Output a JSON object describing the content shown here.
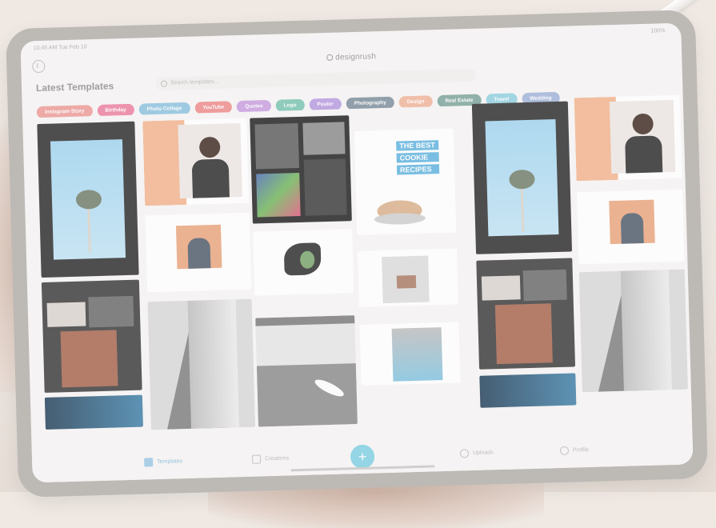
{
  "app": {
    "status_time": "10:45 AM  Tue Feb 10",
    "status_battery": "100%",
    "logo_text": "designrush",
    "page_title": "Latest Templates",
    "search_placeholder": "Search templates..."
  },
  "categories": [
    {
      "label": "Instagram Story",
      "color": "#ec9c97"
    },
    {
      "label": "Birthday",
      "color": "#ec7fa0"
    },
    {
      "label": "Photo Collage",
      "color": "#8cc2df"
    },
    {
      "label": "YouTube",
      "color": "#ee8a8a"
    },
    {
      "label": "Quotes",
      "color": "#c79ee0"
    },
    {
      "label": "Logo",
      "color": "#78c4b0"
    },
    {
      "label": "Poster",
      "color": "#b69ae0"
    },
    {
      "label": "Photography",
      "color": "#7b8e9c"
    },
    {
      "label": "Design",
      "color": "#f0b59a"
    },
    {
      "label": "Real Estate",
      "color": "#7aa49a"
    },
    {
      "label": "Travel",
      "color": "#8fd0e0"
    },
    {
      "label": "Wedding",
      "color": "#9fb4d8"
    }
  ],
  "cards": {
    "cookie_lines": [
      "THE BEST",
      "COOKIE",
      "RECIPES"
    ]
  },
  "tabbar": {
    "tabs": [
      {
        "label": "Templates",
        "active": true
      },
      {
        "label": "Creations",
        "active": false
      },
      {
        "label": "Uploads",
        "active": false
      },
      {
        "label": "Profile",
        "active": false
      }
    ],
    "fab_label": "+"
  },
  "colors": {
    "accent": "#7fd0e4",
    "background": "#f6f5f4"
  }
}
